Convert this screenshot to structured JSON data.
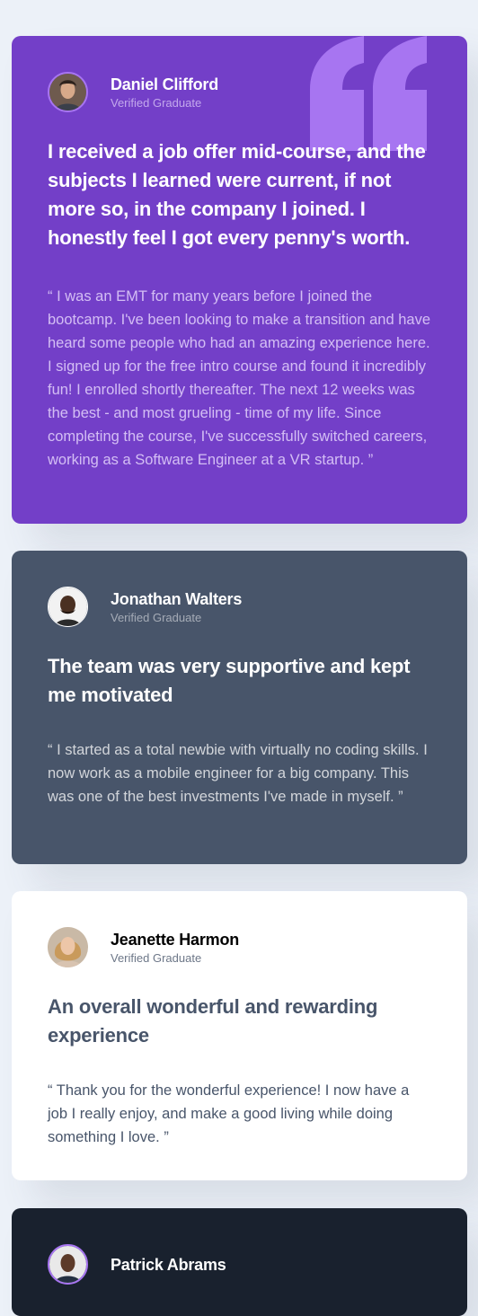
{
  "testimonials": [
    {
      "name": "Daniel Clifford",
      "role": "Verified Graduate",
      "title": "I received a job offer mid-course, and the subjects I learned were current, if not more so, in the company I joined. I honestly feel I got every penny's worth.",
      "quote": "“ I was an EMT for many years before I joined the bootcamp. I've been looking to make a transition and have heard some people who had an amazing experience here. I signed up for the free intro course and found it incredibly fun! I enrolled shortly thereafter. The next 12 weeks was the best - and most grueling - time of my life. Since completing the course, I've successfully switched careers, working as a Software Engineer at a VR startup. ”",
      "color": "#733FC8"
    },
    {
      "name": "Jonathan Walters",
      "role": "Verified Graduate",
      "title": "The team was very supportive and kept me motivated",
      "quote": "“ I started as a total newbie with virtually no coding skills. I now work as a mobile engineer for a big company. This was one of the best investments I've made in myself. ”",
      "color": "#48556A"
    },
    {
      "name": "Jeanette Harmon",
      "role": "Verified Graduate",
      "title": "An overall wonderful and rewarding experience",
      "quote": "“ Thank you for the wonderful experience! I now have a job I really enjoy, and make a good living while doing something I love. ”",
      "color": "#FFFFFF"
    },
    {
      "name": "Patrick Abrams",
      "color": "#19212E"
    }
  ],
  "icons": {
    "quote": "quote-mark-icon"
  }
}
